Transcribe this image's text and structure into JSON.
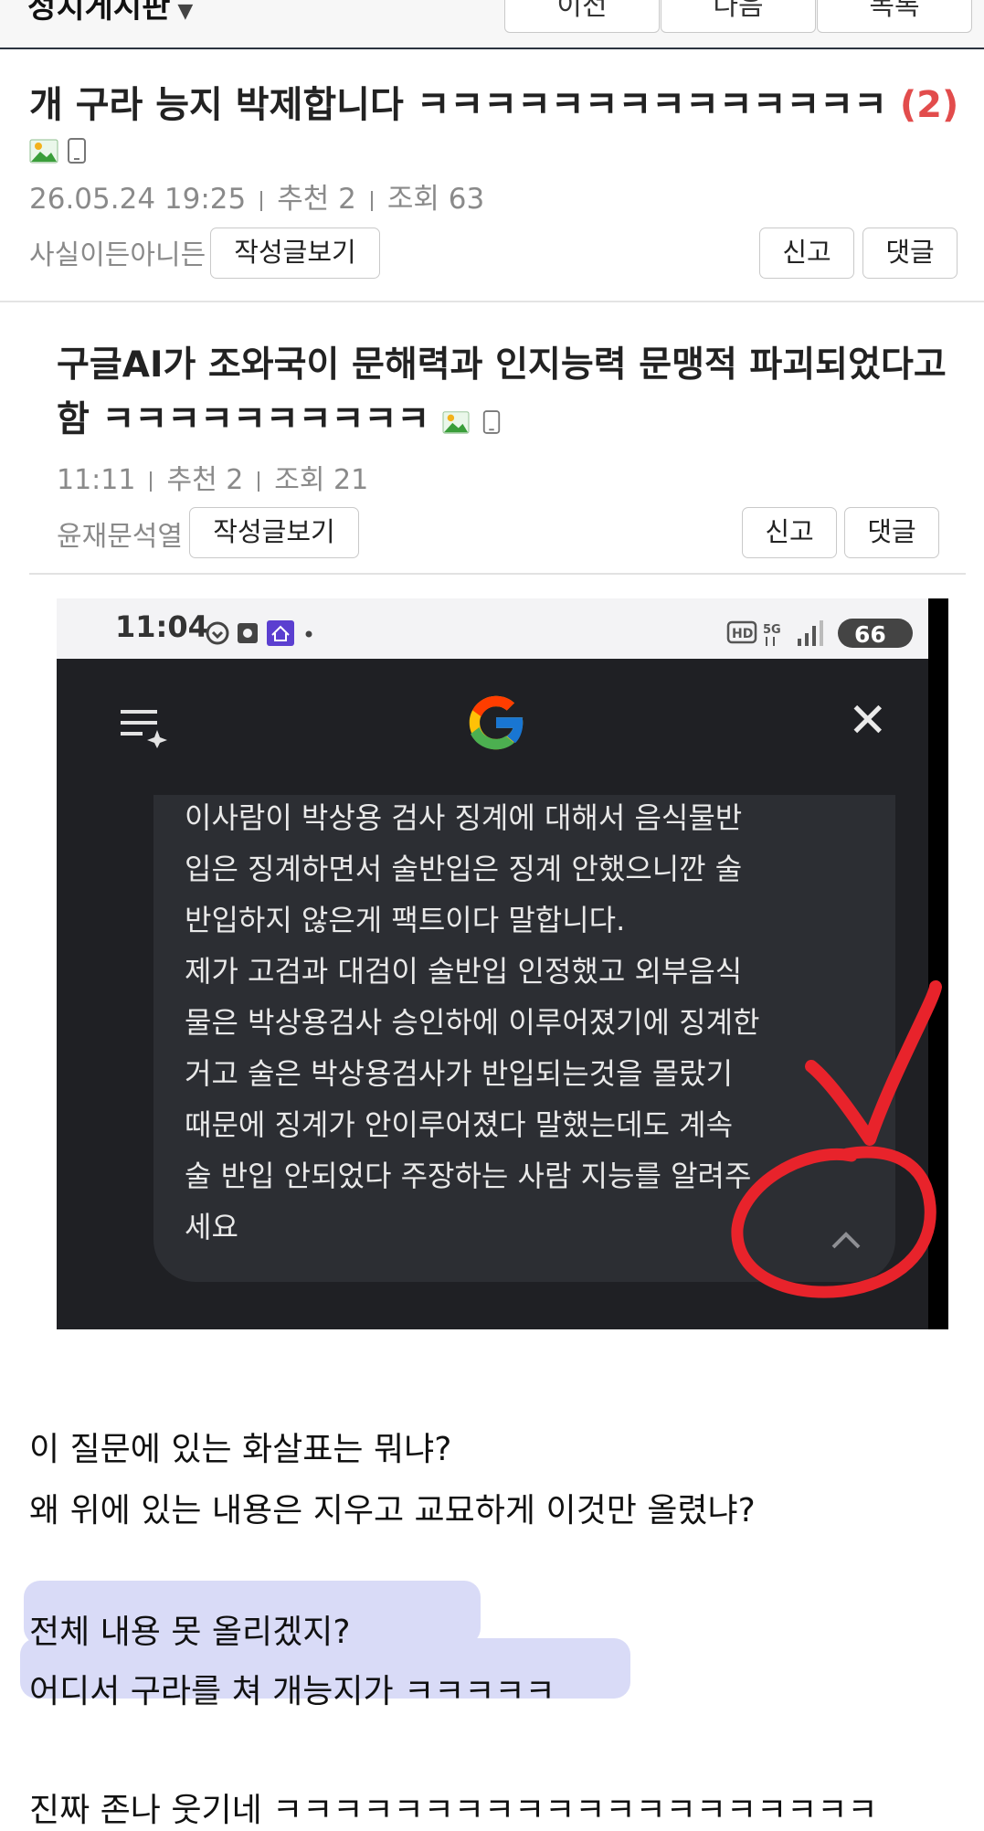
{
  "nav": {
    "board_name": "정치게시판",
    "prev_label": "이전",
    "next_label": "다음",
    "list_label": "목록"
  },
  "post1": {
    "title": "개 구라 능지 박제합니다 ㅋㅋㅋㅋㅋㅋㅋㅋㅋㅋㅋㅋㅋㅋ",
    "comment_count": "(2)",
    "date": "26.05.24  19:25",
    "recommend": "추천 2",
    "views": "조회 63",
    "author": "사실이든아니든",
    "view_posts_label": "작성글보기",
    "report_label": "신고",
    "comment_label": "댓글",
    "icons": [
      "image-icon",
      "mobile-icon"
    ]
  },
  "post2": {
    "title": "구글AI가 조와국이 문해력과 인지능력 문맹적 파괴되었다고 함 ㅋㅋㅋㅋㅋㅋㅋㅋㅋㅋ",
    "time": "11:11",
    "recommend": "추천 2",
    "views": "조회 21",
    "author": "윤재문석열",
    "view_posts_label": "작성글보기",
    "report_label": "신고",
    "comment_label": "댓글",
    "icons": [
      "image-icon",
      "mobile-icon"
    ]
  },
  "screenshot": {
    "status_time": "11:04",
    "battery": "66",
    "status_icons": [
      "heart-icon",
      "alarm-icon",
      "home-app-icon",
      "hd-icon",
      "5g-icon",
      "signal-icon"
    ],
    "logo": "google-g-logo",
    "menu_icon": "sparkle-list-icon",
    "close_icon": "close-icon",
    "text": "이사람이 박상용 검사 징계에 대해서 음식물반\n입은 징계하면서 술반입은 징계 안했으니깐 술\n반입하지 않은게 팩트이다 말합니다.\n제가 고검과 대검이 술반입 인정했고 외부음식\n물은 박상용검사 승인하에 이루어졌기에 징계한\n거고 술은 박상용검사가 반입되는것을 몰랐기\n때문에 징계가 안이루어졌다 말했는데도 계속\n술 반입 안되었다 주장하는 사람 지능를 알려주\n세요",
    "annotation_color": "#e8232b"
  },
  "body": {
    "line1": "이 질문에 있는 화살표는 뭐냐?",
    "line2": "왜 위에 있는 내용은 지우고 교묘하게 이것만 올렸냐?",
    "line3": "전체 내용 못 올리겠지?",
    "line4": "어디서 구라를 쳐 개능지가 ㅋㅋㅋㅋㅋ",
    "line5": "진짜 존나 웃기네 ㅋㅋㅋㅋㅋㅋㅋㅋㅋㅋㅋㅋㅋㅋㅋㅋㅋㅋㅋㅋ",
    "highlight_color": "#d9dbf7"
  }
}
